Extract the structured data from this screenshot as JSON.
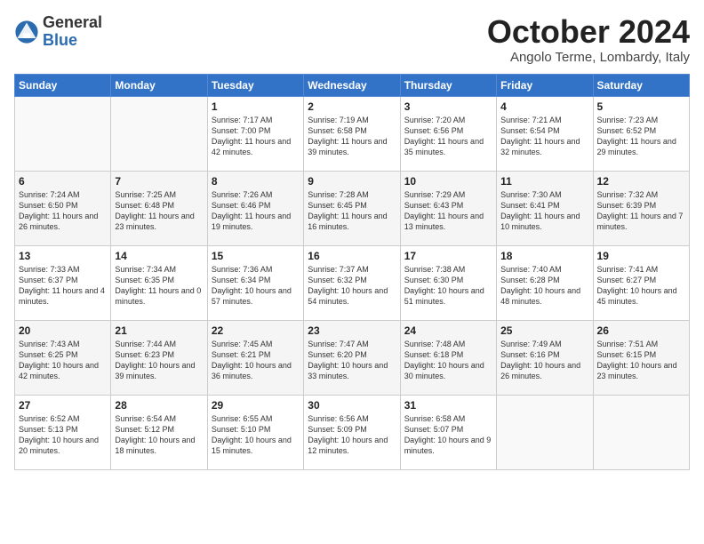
{
  "logo": {
    "general": "General",
    "blue": "Blue"
  },
  "title": "October 2024",
  "location": "Angolo Terme, Lombardy, Italy",
  "days_of_week": [
    "Sunday",
    "Monday",
    "Tuesday",
    "Wednesday",
    "Thursday",
    "Friday",
    "Saturday"
  ],
  "weeks": [
    [
      {
        "day": "",
        "details": ""
      },
      {
        "day": "",
        "details": ""
      },
      {
        "day": "1",
        "details": "Sunrise: 7:17 AM\nSunset: 7:00 PM\nDaylight: 11 hours and 42 minutes."
      },
      {
        "day": "2",
        "details": "Sunrise: 7:19 AM\nSunset: 6:58 PM\nDaylight: 11 hours and 39 minutes."
      },
      {
        "day": "3",
        "details": "Sunrise: 7:20 AM\nSunset: 6:56 PM\nDaylight: 11 hours and 35 minutes."
      },
      {
        "day": "4",
        "details": "Sunrise: 7:21 AM\nSunset: 6:54 PM\nDaylight: 11 hours and 32 minutes."
      },
      {
        "day": "5",
        "details": "Sunrise: 7:23 AM\nSunset: 6:52 PM\nDaylight: 11 hours and 29 minutes."
      }
    ],
    [
      {
        "day": "6",
        "details": "Sunrise: 7:24 AM\nSunset: 6:50 PM\nDaylight: 11 hours and 26 minutes."
      },
      {
        "day": "7",
        "details": "Sunrise: 7:25 AM\nSunset: 6:48 PM\nDaylight: 11 hours and 23 minutes."
      },
      {
        "day": "8",
        "details": "Sunrise: 7:26 AM\nSunset: 6:46 PM\nDaylight: 11 hours and 19 minutes."
      },
      {
        "day": "9",
        "details": "Sunrise: 7:28 AM\nSunset: 6:45 PM\nDaylight: 11 hours and 16 minutes."
      },
      {
        "day": "10",
        "details": "Sunrise: 7:29 AM\nSunset: 6:43 PM\nDaylight: 11 hours and 13 minutes."
      },
      {
        "day": "11",
        "details": "Sunrise: 7:30 AM\nSunset: 6:41 PM\nDaylight: 11 hours and 10 minutes."
      },
      {
        "day": "12",
        "details": "Sunrise: 7:32 AM\nSunset: 6:39 PM\nDaylight: 11 hours and 7 minutes."
      }
    ],
    [
      {
        "day": "13",
        "details": "Sunrise: 7:33 AM\nSunset: 6:37 PM\nDaylight: 11 hours and 4 minutes."
      },
      {
        "day": "14",
        "details": "Sunrise: 7:34 AM\nSunset: 6:35 PM\nDaylight: 11 hours and 0 minutes."
      },
      {
        "day": "15",
        "details": "Sunrise: 7:36 AM\nSunset: 6:34 PM\nDaylight: 10 hours and 57 minutes."
      },
      {
        "day": "16",
        "details": "Sunrise: 7:37 AM\nSunset: 6:32 PM\nDaylight: 10 hours and 54 minutes."
      },
      {
        "day": "17",
        "details": "Sunrise: 7:38 AM\nSunset: 6:30 PM\nDaylight: 10 hours and 51 minutes."
      },
      {
        "day": "18",
        "details": "Sunrise: 7:40 AM\nSunset: 6:28 PM\nDaylight: 10 hours and 48 minutes."
      },
      {
        "day": "19",
        "details": "Sunrise: 7:41 AM\nSunset: 6:27 PM\nDaylight: 10 hours and 45 minutes."
      }
    ],
    [
      {
        "day": "20",
        "details": "Sunrise: 7:43 AM\nSunset: 6:25 PM\nDaylight: 10 hours and 42 minutes."
      },
      {
        "day": "21",
        "details": "Sunrise: 7:44 AM\nSunset: 6:23 PM\nDaylight: 10 hours and 39 minutes."
      },
      {
        "day": "22",
        "details": "Sunrise: 7:45 AM\nSunset: 6:21 PM\nDaylight: 10 hours and 36 minutes."
      },
      {
        "day": "23",
        "details": "Sunrise: 7:47 AM\nSunset: 6:20 PM\nDaylight: 10 hours and 33 minutes."
      },
      {
        "day": "24",
        "details": "Sunrise: 7:48 AM\nSunset: 6:18 PM\nDaylight: 10 hours and 30 minutes."
      },
      {
        "day": "25",
        "details": "Sunrise: 7:49 AM\nSunset: 6:16 PM\nDaylight: 10 hours and 26 minutes."
      },
      {
        "day": "26",
        "details": "Sunrise: 7:51 AM\nSunset: 6:15 PM\nDaylight: 10 hours and 23 minutes."
      }
    ],
    [
      {
        "day": "27",
        "details": "Sunrise: 6:52 AM\nSunset: 5:13 PM\nDaylight: 10 hours and 20 minutes."
      },
      {
        "day": "28",
        "details": "Sunrise: 6:54 AM\nSunset: 5:12 PM\nDaylight: 10 hours and 18 minutes."
      },
      {
        "day": "29",
        "details": "Sunrise: 6:55 AM\nSunset: 5:10 PM\nDaylight: 10 hours and 15 minutes."
      },
      {
        "day": "30",
        "details": "Sunrise: 6:56 AM\nSunset: 5:09 PM\nDaylight: 10 hours and 12 minutes."
      },
      {
        "day": "31",
        "details": "Sunrise: 6:58 AM\nSunset: 5:07 PM\nDaylight: 10 hours and 9 minutes."
      },
      {
        "day": "",
        "details": ""
      },
      {
        "day": "",
        "details": ""
      }
    ]
  ]
}
